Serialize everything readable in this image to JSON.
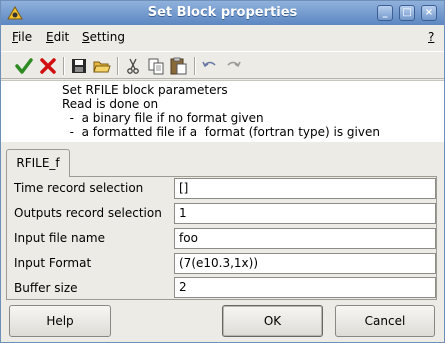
{
  "window": {
    "title": "Set Block properties",
    "controls": {
      "minimize": "_",
      "maximize": "□",
      "close": "×"
    }
  },
  "menubar": {
    "file": {
      "mnemonic": "F",
      "rest": "ile"
    },
    "edit": {
      "mnemonic": "E",
      "rest": "dit"
    },
    "setting": {
      "mnemonic": "S",
      "rest": "etting"
    },
    "help": "?"
  },
  "toolbar": {
    "icons": [
      "ok-icon",
      "cancel-icon",
      "save-icon",
      "open-icon",
      "cut-icon",
      "copy-icon",
      "paste-icon",
      "undo-icon",
      "redo-icon"
    ],
    "colors": {
      "ok": "#2e8b22",
      "cancel": "#d01010"
    }
  },
  "description": {
    "lines": [
      "Set RFILE block parameters",
      "Read is done on",
      "  -  a binary file if no format given",
      "  -  a formatted file if a  format (fortran type) is given"
    ]
  },
  "tabs": [
    {
      "label": "RFILE_f"
    }
  ],
  "form": {
    "rows": [
      {
        "label": "Time record selection",
        "value": "[]"
      },
      {
        "label": "Outputs record selection",
        "value": "1"
      },
      {
        "label": "Input file name",
        "value": "foo"
      },
      {
        "label": "Input Format",
        "value": "(7(e10.3,1x))"
      },
      {
        "label": "Buffer size",
        "value": "2"
      }
    ]
  },
  "buttons": {
    "help": "Help",
    "ok": "OK",
    "cancel": "Cancel"
  }
}
